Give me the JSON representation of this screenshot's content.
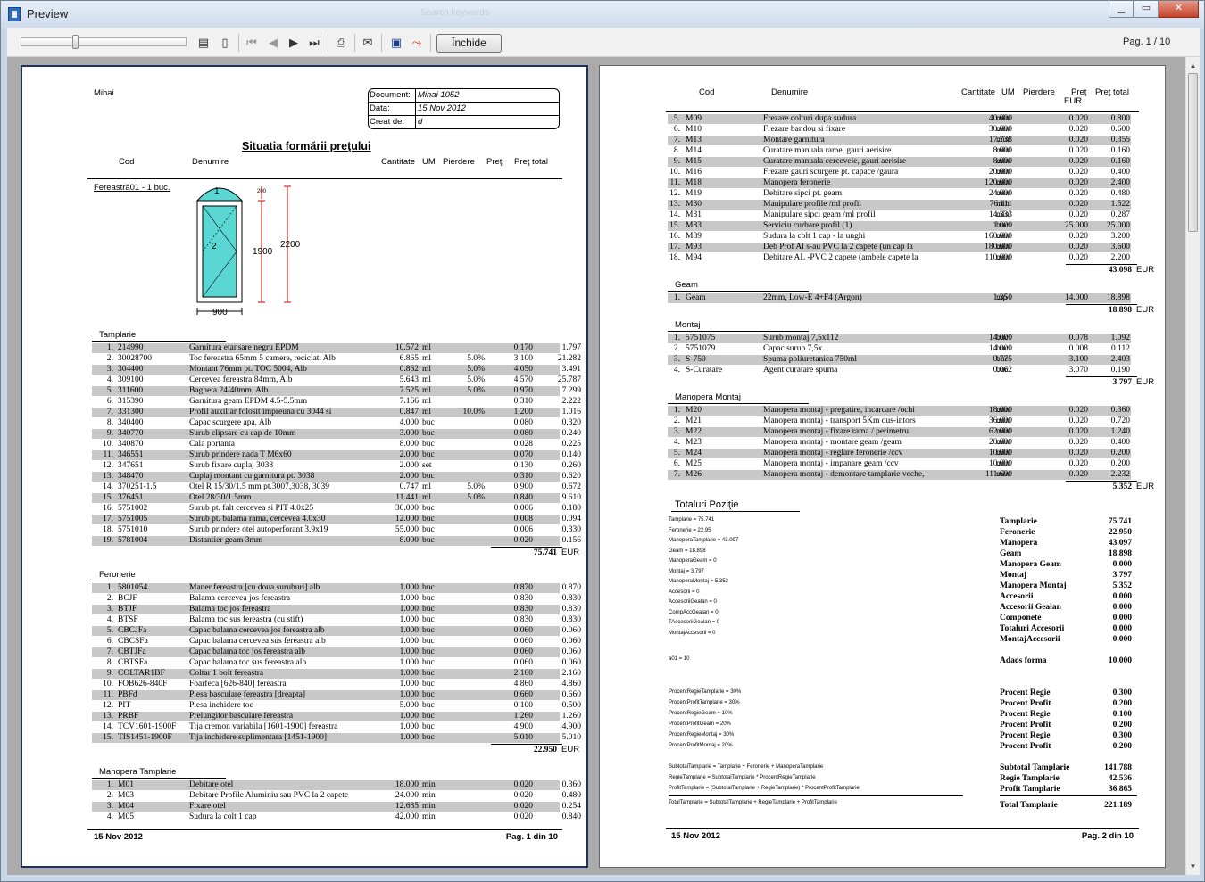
{
  "window": {
    "title": "Preview",
    "ghost_text": "Search keywords",
    "close_button": "Închide",
    "page_indicator": "Pag. 1 / 10"
  },
  "page1": {
    "company": "Mihai",
    "doc_info": [
      [
        "Document:",
        "Mihai 1052"
      ],
      [
        "Data:",
        "15 Nov 2012"
      ],
      [
        "Creat de:",
        "d"
      ]
    ],
    "title": "Situatia formării preţului",
    "headers": {
      "cod": "Cod",
      "denumire": "Denumire",
      "cantitate": "Cantitate",
      "um": "UM",
      "pierdere": "Pierdere",
      "pret": "Preţ",
      "pret_total": "Preţ total"
    },
    "window_label": "Fereastră01 - 1 buc.",
    "drawing": {
      "w": "900",
      "h1": "1900",
      "h2": "2200",
      "top": "200",
      "n1": "1",
      "n2": "2"
    },
    "sections": [
      {
        "name": "Tamplarie",
        "total": "75.741",
        "cur": "EUR",
        "rows": [
          [
            "1.",
            "214990",
            "Garnitura etansare negru EPDM",
            "10.572",
            "ml",
            "",
            "0.170",
            "1.797"
          ],
          [
            "2.",
            "30028700",
            "Toc fereastra 65mm 5 camere, reciclat, Alb",
            "6.865",
            "ml",
            "5.0%",
            "3.100",
            "21.282"
          ],
          [
            "3.",
            "304400",
            "Montant 76mm pt. TOC 5004, Alb",
            "0.862",
            "ml",
            "5.0%",
            "4.050",
            "3.491"
          ],
          [
            "4.",
            "309100",
            "Cercevea fereastra 84mm, Alb",
            "5.643",
            "ml",
            "5.0%",
            "4.570",
            "25.787"
          ],
          [
            "5.",
            "311600",
            "Bagheta 24/40mm, Alb",
            "7.525",
            "ml",
            "5.0%",
            "0.970",
            "7.299"
          ],
          [
            "6.",
            "315390",
            "Garnitura geam EPDM 4.5-5.5mm",
            "7.166",
            "ml",
            "",
            "0.310",
            "2.222"
          ],
          [
            "7.",
            "331300",
            "Profil auxiliar folosit impreuna cu 3044 si",
            "0.847",
            "ml",
            "10.0%",
            "1.200",
            "1.016"
          ],
          [
            "8.",
            "340400",
            "Capac scurgere apa, Alb",
            "4.000",
            "buc",
            "",
            "0.080",
            "0.320"
          ],
          [
            "9.",
            "340770",
            "Surub clipsare cu cap de 10mm",
            "3.000",
            "buc",
            "",
            "0.080",
            "0.240"
          ],
          [
            "10.",
            "340870",
            "Cala portanta",
            "8.000",
            "buc",
            "",
            "0.028",
            "0.225"
          ],
          [
            "11.",
            "346551",
            "Surub prindere nada T M6x60",
            "2.000",
            "buc",
            "",
            "0.070",
            "0.140"
          ],
          [
            "12.",
            "347651",
            "Surub fixare cuplaj 3038",
            "2.000",
            "set",
            "",
            "0.130",
            "0.260"
          ],
          [
            "13.",
            "348470",
            "Cuplaj montant cu garnitura pt. 3038",
            "2.000",
            "buc",
            "",
            "0.310",
            "0.620"
          ],
          [
            "14.",
            "370251-1.5",
            "Otel R 15/30/1.5 mm pt.3007,3038, 3039",
            "0.747",
            "ml",
            "5.0%",
            "0.900",
            "0.672"
          ],
          [
            "15.",
            "376451",
            "Otel 28/30/1.5mm",
            "11.441",
            "ml",
            "5.0%",
            "0.840",
            "9.610"
          ],
          [
            "16.",
            "5751002",
            "Surub pt. falt cercevea si PIT 4.0x25",
            "30.000",
            "buc",
            "",
            "0.006",
            "0.180"
          ],
          [
            "17.",
            "5751005",
            "Surub pt. balama rama, cercevea 4.0x30",
            "12.000",
            "buc",
            "",
            "0.008",
            "0.094"
          ],
          [
            "18.",
            "5751010",
            "Surub prindere otel autoperforant 3.9x19",
            "55.000",
            "buc",
            "",
            "0.006",
            "0.330"
          ],
          [
            "19.",
            "5781004",
            "Distantier geam 3mm",
            "8.000",
            "buc",
            "",
            "0.020",
            "0.156"
          ]
        ]
      },
      {
        "name": "Feronerie",
        "total": "22.950",
        "cur": "EUR",
        "rows": [
          [
            "1.",
            "5801054",
            "Maner fereastra [cu doua suruburi] alb",
            "1.000",
            "buc",
            "",
            "0.870",
            "0.870"
          ],
          [
            "2.",
            "BCJF",
            "Balama cercevea jos fereastra",
            "1.000",
            "buc",
            "",
            "0.830",
            "0.830"
          ],
          [
            "3.",
            "BTJF",
            "Balama toc jos fereastra",
            "1.000",
            "buc",
            "",
            "0.830",
            "0.830"
          ],
          [
            "4.",
            "BTSF",
            "Balama toc sus fereastra (cu stift)",
            "1.000",
            "buc",
            "",
            "0.830",
            "0.830"
          ],
          [
            "5.",
            "CBCJFa",
            "Capac balama cercevea jos fereastra alb",
            "1.000",
            "buc",
            "",
            "0.060",
            "0.060"
          ],
          [
            "6.",
            "CBCSFa",
            "Capac balama cercevea sus fereastra alb",
            "1.000",
            "buc",
            "",
            "0.060",
            "0.060"
          ],
          [
            "7.",
            "CBTJFa",
            "Capac balama toc jos fereastra alb",
            "1.000",
            "buc",
            "",
            "0.060",
            "0.060"
          ],
          [
            "8.",
            "CBTSFa",
            "Capac balama toc sus fereastra alb",
            "1.000",
            "buc",
            "",
            "0.060",
            "0.060"
          ],
          [
            "9.",
            "COLTAR1BF",
            "Coltar 1 bolt fereastra",
            "1.000",
            "buc",
            "",
            "2.160",
            "2.160"
          ],
          [
            "10.",
            "FOB626-840F",
            "Foarfeca [626-840] fereastra",
            "1.000",
            "buc",
            "",
            "4.860",
            "4.860"
          ],
          [
            "11.",
            "PBFd",
            "Piesa basculare fereastra [dreapta]",
            "1.000",
            "buc",
            "",
            "0.660",
            "0.660"
          ],
          [
            "12.",
            "PIT",
            "Piesa inchidere toc",
            "5.000",
            "buc",
            "",
            "0.100",
            "0.500"
          ],
          [
            "13.",
            "PRBF",
            "Prelungitor basculare fereastra",
            "1.000",
            "buc",
            "",
            "1.260",
            "1.260"
          ],
          [
            "14.",
            "TCV1601-1900F",
            "Tija cremon variabila [1601-1900] fereastra",
            "1.000",
            "buc",
            "",
            "4.900",
            "4.900"
          ],
          [
            "15.",
            "TIS1451-1900F",
            "Tija inchidere suplimentara [1451-1900]",
            "1.000",
            "buc",
            "",
            "5.010",
            "5.010"
          ]
        ]
      },
      {
        "name": "Manopera Tamplarie",
        "total": "",
        "cur": "",
        "rows": [
          [
            "1.",
            "M01",
            "Debitare otel",
            "18.000",
            "min",
            "",
            "0.020",
            "0.360"
          ],
          [
            "2.",
            "M03",
            "Debitare Profile Aluminiu sau PVC la 2 capete",
            "24.000",
            "min",
            "",
            "0.020",
            "0.480"
          ],
          [
            "3.",
            "M04",
            "Fixare otel",
            "12.685",
            "min",
            "",
            "0.020",
            "0.254"
          ],
          [
            "4.",
            "M05",
            "Sudura la colt 1 cap",
            "42.000",
            "min",
            "",
            "0.020",
            "0.840"
          ]
        ]
      }
    ],
    "footer_date": "15 Nov 2012",
    "footer_page": "Pag. 1 din 10"
  },
  "page2": {
    "headers": {
      "cod": "Cod",
      "denumire": "Denumire",
      "cantitate": "Cantitate",
      "um": "UM",
      "pierdere": "Pierdere",
      "pret": "Preţ",
      "pret_unit": "EUR",
      "pret_total": "Preţ total"
    },
    "sections": [
      {
        "name": "",
        "total": "43.098",
        "cur": "EUR",
        "rows": [
          [
            "5.",
            "M09",
            "Frezare colturi dupa sudura",
            "40.000",
            "min",
            "",
            "0.020",
            "0.800"
          ],
          [
            "6.",
            "M10",
            "Frezare bandou si fixare",
            "30.000",
            "min",
            "",
            "0.020",
            "0.600"
          ],
          [
            "7.",
            "M13",
            "Montare garnitura",
            "17.738",
            "min",
            "",
            "0.020",
            "0.355"
          ],
          [
            "8.",
            "M14",
            "Curatare manuala rame, gauri aerisire",
            "8.000",
            "min",
            "",
            "0.020",
            "0.160"
          ],
          [
            "9.",
            "M15",
            "Curatare manuala cercevele, gauri aerisire",
            "8.000",
            "min",
            "",
            "0.020",
            "0.160"
          ],
          [
            "10.",
            "M16",
            "Frezare gauri scurgere pt. capace /gaura",
            "20.000",
            "min",
            "",
            "0.020",
            "0.400"
          ],
          [
            "11.",
            "M18",
            "Manopera feronerie",
            "120.000",
            "min",
            "",
            "0.020",
            "2.400"
          ],
          [
            "12.",
            "M19",
            "Debitare sipci pt. geam",
            "24.000",
            "min",
            "",
            "0.020",
            "0.480"
          ],
          [
            "13.",
            "M30",
            "Manipulare profile /ml profil",
            "76.111",
            "min",
            "",
            "0.020",
            "1.522"
          ],
          [
            "14.",
            "M31",
            "Manipulare sipci geam /ml profil",
            "14.333",
            "min",
            "",
            "0.020",
            "0.287"
          ],
          [
            "15.",
            "M83",
            "Serviciu curbare profil (1)",
            "1.000",
            "buc",
            "",
            "25.000",
            "25.000"
          ],
          [
            "16.",
            "M89",
            "Sudura la colt 1 cap - la unghi",
            "160.000",
            "min",
            "",
            "0.020",
            "3.200"
          ],
          [
            "17.",
            "M93",
            "Deb Prof Al s-au PVC la 2 capete (un cap la",
            "180.000",
            "min",
            "",
            "0.020",
            "3.600"
          ],
          [
            "18.",
            "M94",
            "Debitare AL -PVC 2 capete (ambele capete la",
            "110.000",
            "min",
            "",
            "0.020",
            "2.200"
          ]
        ]
      },
      {
        "name": "Geam",
        "total": "18.898",
        "cur": "EUR",
        "rows": [
          [
            "1.",
            "Geam",
            "22mm, Low-E 4+F4 (Argon)",
            "1.350",
            "mp",
            "",
            "14.000",
            "18.898"
          ]
        ]
      },
      {
        "name": "Montaj",
        "total": "3.797",
        "cur": "EUR",
        "rows": [
          [
            "1.",
            "5751075",
            "Surub montaj 7,5x112",
            "14.000",
            "buc",
            "",
            "0.078",
            "1.092"
          ],
          [
            "2.",
            "5751079",
            "Capac surub 7,5x...",
            "14.000",
            "buc",
            "",
            "0.008",
            "0.112"
          ],
          [
            "3.",
            "S-750",
            "Spuma poliuretanica 750ml",
            "0.775",
            "buc",
            "",
            "3.100",
            "2.403"
          ],
          [
            "4.",
            "S-Curatare",
            "Agent curatare spuma",
            "0.062",
            "buc",
            "",
            "3.070",
            "0.190"
          ]
        ]
      },
      {
        "name": "Manopera Montaj",
        "total": "5.352",
        "cur": "EUR",
        "rows": [
          [
            "1.",
            "M20",
            "Manopera montaj - pregatire, incarcare /ochi",
            "18.000",
            "min",
            "",
            "0.020",
            "0.360"
          ],
          [
            "2.",
            "M21",
            "Manopera montaj - transport 5Km dus-intors",
            "36.000",
            "min",
            "",
            "0.020",
            "0.720"
          ],
          [
            "3.",
            "M22",
            "Manopera montaj - fixare rama / perimetru",
            "62.000",
            "min",
            "",
            "0.020",
            "1.240"
          ],
          [
            "4.",
            "M23",
            "Manopera montaj - montare geam /geam",
            "20.000",
            "min",
            "",
            "0.020",
            "0.400"
          ],
          [
            "5.",
            "M24",
            "Manopera montaj - reglare feronerie /ccv",
            "10.000",
            "min",
            "",
            "0.020",
            "0.200"
          ],
          [
            "6.",
            "M25",
            "Manopera montaj - impanare geam /ccv",
            "10.000",
            "min",
            "",
            "0.020",
            "0.200"
          ],
          [
            "7.",
            "M26",
            "Manopera montaj - demontare tamplarie veche,",
            "111.600",
            "min",
            "",
            "0.020",
            "2.232"
          ]
        ]
      }
    ],
    "totals_title": "Totaluri Poziţie",
    "formulas_a": [
      "Tamplarie = 75.741",
      "Feronerie = 22.95",
      "ManoperaTamplarie = 43.097",
      "Geam = 18.898",
      "ManoperaGeam = 0",
      "Montaj = 3.797",
      "ManoperaMontaj = 5.352",
      "Accesorii = 0",
      "AccesoriiGealan = 0",
      "CompAccGealan = 0",
      "TAccesoriiGealan = 0",
      "MontajAccesorii = 0"
    ],
    "formula_a01": "a01 = 10",
    "formulas_b": [
      "ProcentRegieTamplarie = 30%",
      "ProcentProfitTamplarie = 30%",
      "ProcentRegieGeam = 10%",
      "ProcentProfitGeam = 20%",
      "ProcentRegieMontaj = 30%",
      "ProcentProfitMontaj = 20%"
    ],
    "formulas_c": [
      "SubtotalTamplarie = Tamplarie + Feronerie + ManoperaTamplarie",
      "RegieTamplarie = SubtotalTamplarie * ProcentRegieTamplarie",
      "ProfitTamplarie = (SubtotalTamplarie + RegieTamplarie) * ProcentProfitTamplarie"
    ],
    "formula_total": "TotalTamplarie = SubtotalTamplarie + RegieTamplarie + ProfitTamplarie",
    "sum_a": [
      [
        "Tamplarie",
        "75.741"
      ],
      [
        "Feronerie",
        "22.950"
      ],
      [
        "Manopera",
        "43.097"
      ],
      [
        "Geam",
        "18.898"
      ],
      [
        "Manopera Geam",
        "0.000"
      ],
      [
        "Montaj",
        "3.797"
      ],
      [
        "Manopera Montaj",
        "5.352"
      ],
      [
        "Accesorii",
        "0.000"
      ],
      [
        "Accesorii Gealan",
        "0.000"
      ],
      [
        "Componete",
        "0.000"
      ],
      [
        "Totaluri Accesorii",
        "0.000"
      ],
      [
        "MontajAccesorii",
        "0.000"
      ]
    ],
    "sum_adaos": [
      "Adaos forma",
      "10.000"
    ],
    "sum_b": [
      [
        "Procent Regie",
        "0.300"
      ],
      [
        "Procent Profit",
        "0.200"
      ],
      [
        "Procent Regie",
        "0.100"
      ],
      [
        "Procent Profit",
        "0.200"
      ],
      [
        "Procent Regie",
        "0.300"
      ],
      [
        "Procent Profit",
        "0.200"
      ]
    ],
    "sum_c": [
      [
        "Subtotal Tamplarie",
        "141.788"
      ],
      [
        "Regie Tamplarie",
        "42.536"
      ],
      [
        "Profit Tamplarie",
        "36.865"
      ]
    ],
    "sum_total": [
      "Total Tamplarie",
      "221.189"
    ],
    "footer_date": "15 Nov 2012",
    "footer_page": "Pag. 2 din 10"
  }
}
